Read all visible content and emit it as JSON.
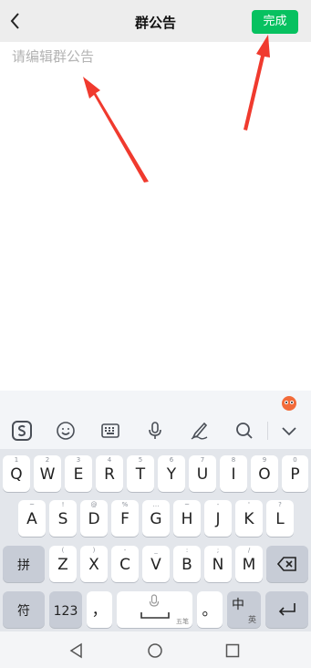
{
  "header": {
    "title": "群公告",
    "back_icon": "chevron-left-icon",
    "done_label": "完成",
    "done_color": "#07c160"
  },
  "editor": {
    "placeholder": "请编辑群公告"
  },
  "keyboard": {
    "toolbar_icons": [
      "sogou-logo-icon",
      "emoji-icon",
      "keyboard-icon",
      "microphone-icon",
      "handwriting-icon",
      "search-icon",
      "chevron-down-icon"
    ],
    "row1": [
      {
        "hint": "1",
        "key": "Q"
      },
      {
        "hint": "2",
        "key": "W"
      },
      {
        "hint": "3",
        "key": "E"
      },
      {
        "hint": "4",
        "key": "R"
      },
      {
        "hint": "5",
        "key": "T"
      },
      {
        "hint": "6",
        "key": "Y"
      },
      {
        "hint": "7",
        "key": "U"
      },
      {
        "hint": "8",
        "key": "I"
      },
      {
        "hint": "9",
        "key": "O"
      },
      {
        "hint": "0",
        "key": "P"
      }
    ],
    "row2": [
      {
        "hint": "~",
        "key": "A"
      },
      {
        "hint": "!",
        "key": "S"
      },
      {
        "hint": "@",
        "key": "D"
      },
      {
        "hint": "%",
        "key": "F"
      },
      {
        "hint": "…",
        "key": "G"
      },
      {
        "hint": "~",
        "key": "H"
      },
      {
        "hint": "-",
        "key": "J"
      },
      {
        "hint": "'",
        "key": "K"
      },
      {
        "hint": "?",
        "key": "L"
      }
    ],
    "row3": {
      "shift_label": "拼",
      "letters": [
        {
          "hint": "(",
          "key": "Z"
        },
        {
          "hint": ")",
          "key": "X"
        },
        {
          "hint": "-",
          "key": "C"
        },
        {
          "hint": "_",
          "key": "V"
        },
        {
          "hint": ":",
          "key": "B"
        },
        {
          "hint": ";",
          "key": "N"
        },
        {
          "hint": "/",
          "key": "M"
        }
      ],
      "delete_icon": "backspace-icon"
    },
    "row4": {
      "symbol_label": "符",
      "num_label": "123",
      "comma_label": "，",
      "space_hint": "五笔",
      "period_label": "。",
      "lang_main": "中",
      "lang_sub": "英",
      "enter_icon": "enter-icon"
    }
  },
  "navbar": {
    "icons": [
      "back-triangle-icon",
      "home-circle-icon",
      "recents-square-icon"
    ]
  },
  "colors": {
    "arrow": "#f03a2e"
  }
}
